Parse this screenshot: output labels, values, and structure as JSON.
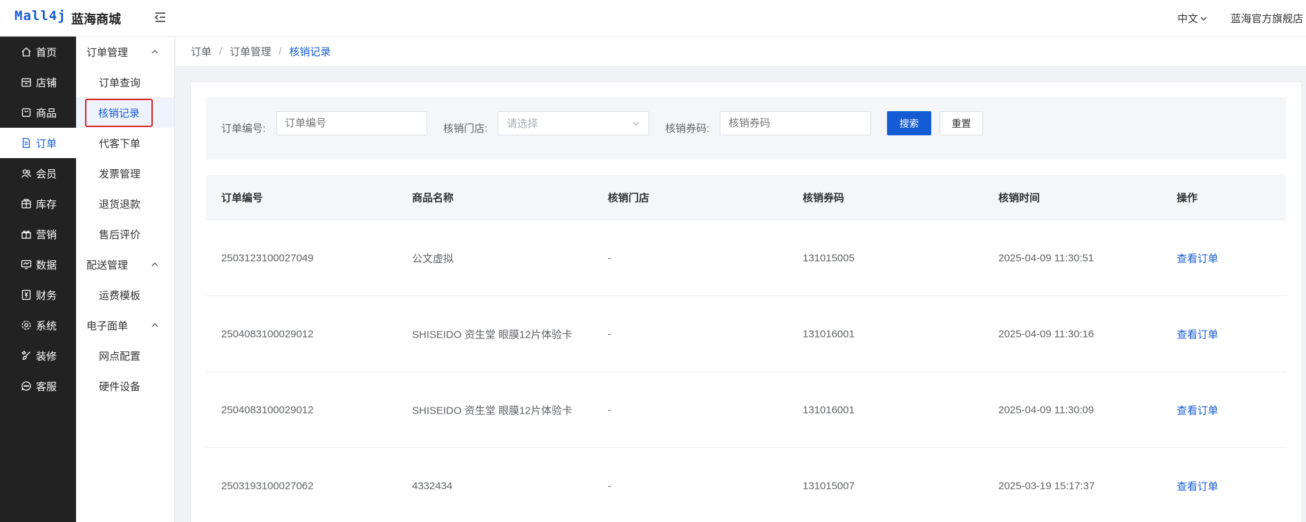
{
  "header": {
    "logo": "Mall4j",
    "shop_name": "蓝海商城",
    "language": "中文",
    "store_name": "蓝海官方旗舰店"
  },
  "primary_nav": [
    {
      "label": "首页",
      "icon": "home-icon"
    },
    {
      "label": "店铺",
      "icon": "store-icon"
    },
    {
      "label": "商品",
      "icon": "goods-icon"
    },
    {
      "label": "订单",
      "icon": "order-icon",
      "active": true
    },
    {
      "label": "会员",
      "icon": "member-icon"
    },
    {
      "label": "库存",
      "icon": "stock-icon"
    },
    {
      "label": "营销",
      "icon": "gift-icon"
    },
    {
      "label": "数据",
      "icon": "chart-icon"
    },
    {
      "label": "财务",
      "icon": "finance-icon"
    },
    {
      "label": "系统",
      "icon": "gear-icon"
    },
    {
      "label": "装修",
      "icon": "brush-icon"
    },
    {
      "label": "客服",
      "icon": "chat-icon"
    }
  ],
  "secondary_nav": {
    "group1": {
      "label": "订单管理",
      "items": [
        "订单查询",
        "核销记录",
        "代客下单",
        "发票管理",
        "退货退款",
        "售后评价"
      ]
    },
    "group2": {
      "label": "配送管理",
      "items": [
        "运费模板"
      ]
    },
    "group3": {
      "label": "电子面单",
      "items": [
        "网点配置",
        "硬件设备"
      ]
    }
  },
  "breadcrumb": [
    "订单",
    "订单管理",
    "核销记录"
  ],
  "search": {
    "order_no_label": "订单编号:",
    "order_no_placeholder": "订单编号",
    "store_label": "核销门店:",
    "store_placeholder": "请选择",
    "code_label": "核销券码:",
    "code_placeholder": "核销券码",
    "search_button": "搜索",
    "reset_button": "重置"
  },
  "table": {
    "columns": [
      "订单编号",
      "商品名称",
      "核销门店",
      "核销券码",
      "核销时间",
      "操作"
    ],
    "rows": [
      {
        "order_no": "2503123100027049",
        "product": "公文虚拟",
        "store": "-",
        "code": "131015005",
        "time": "2025-04-09 11:30:51",
        "action": "查看订单"
      },
      {
        "order_no": "2504083100029012",
        "product": "SHISEIDO 资生堂 眼膜12片体验卡",
        "store": "-",
        "code": "131016001",
        "time": "2025-04-09 11:30:16",
        "action": "查看订单"
      },
      {
        "order_no": "2504083100029012",
        "product": "SHISEIDO 资生堂 眼膜12片体验卡",
        "store": "-",
        "code": "131016001",
        "time": "2025-04-09 11:30:09",
        "action": "查看订单"
      },
      {
        "order_no": "2503193100027062",
        "product": "4332434",
        "store": "-",
        "code": "131015007",
        "time": "2025-03-19 15:17:37",
        "action": "查看订单"
      }
    ]
  },
  "colors": {
    "primary": "#155bd4",
    "sidebar_bg": "#222222",
    "highlight_border": "#e02020"
  }
}
